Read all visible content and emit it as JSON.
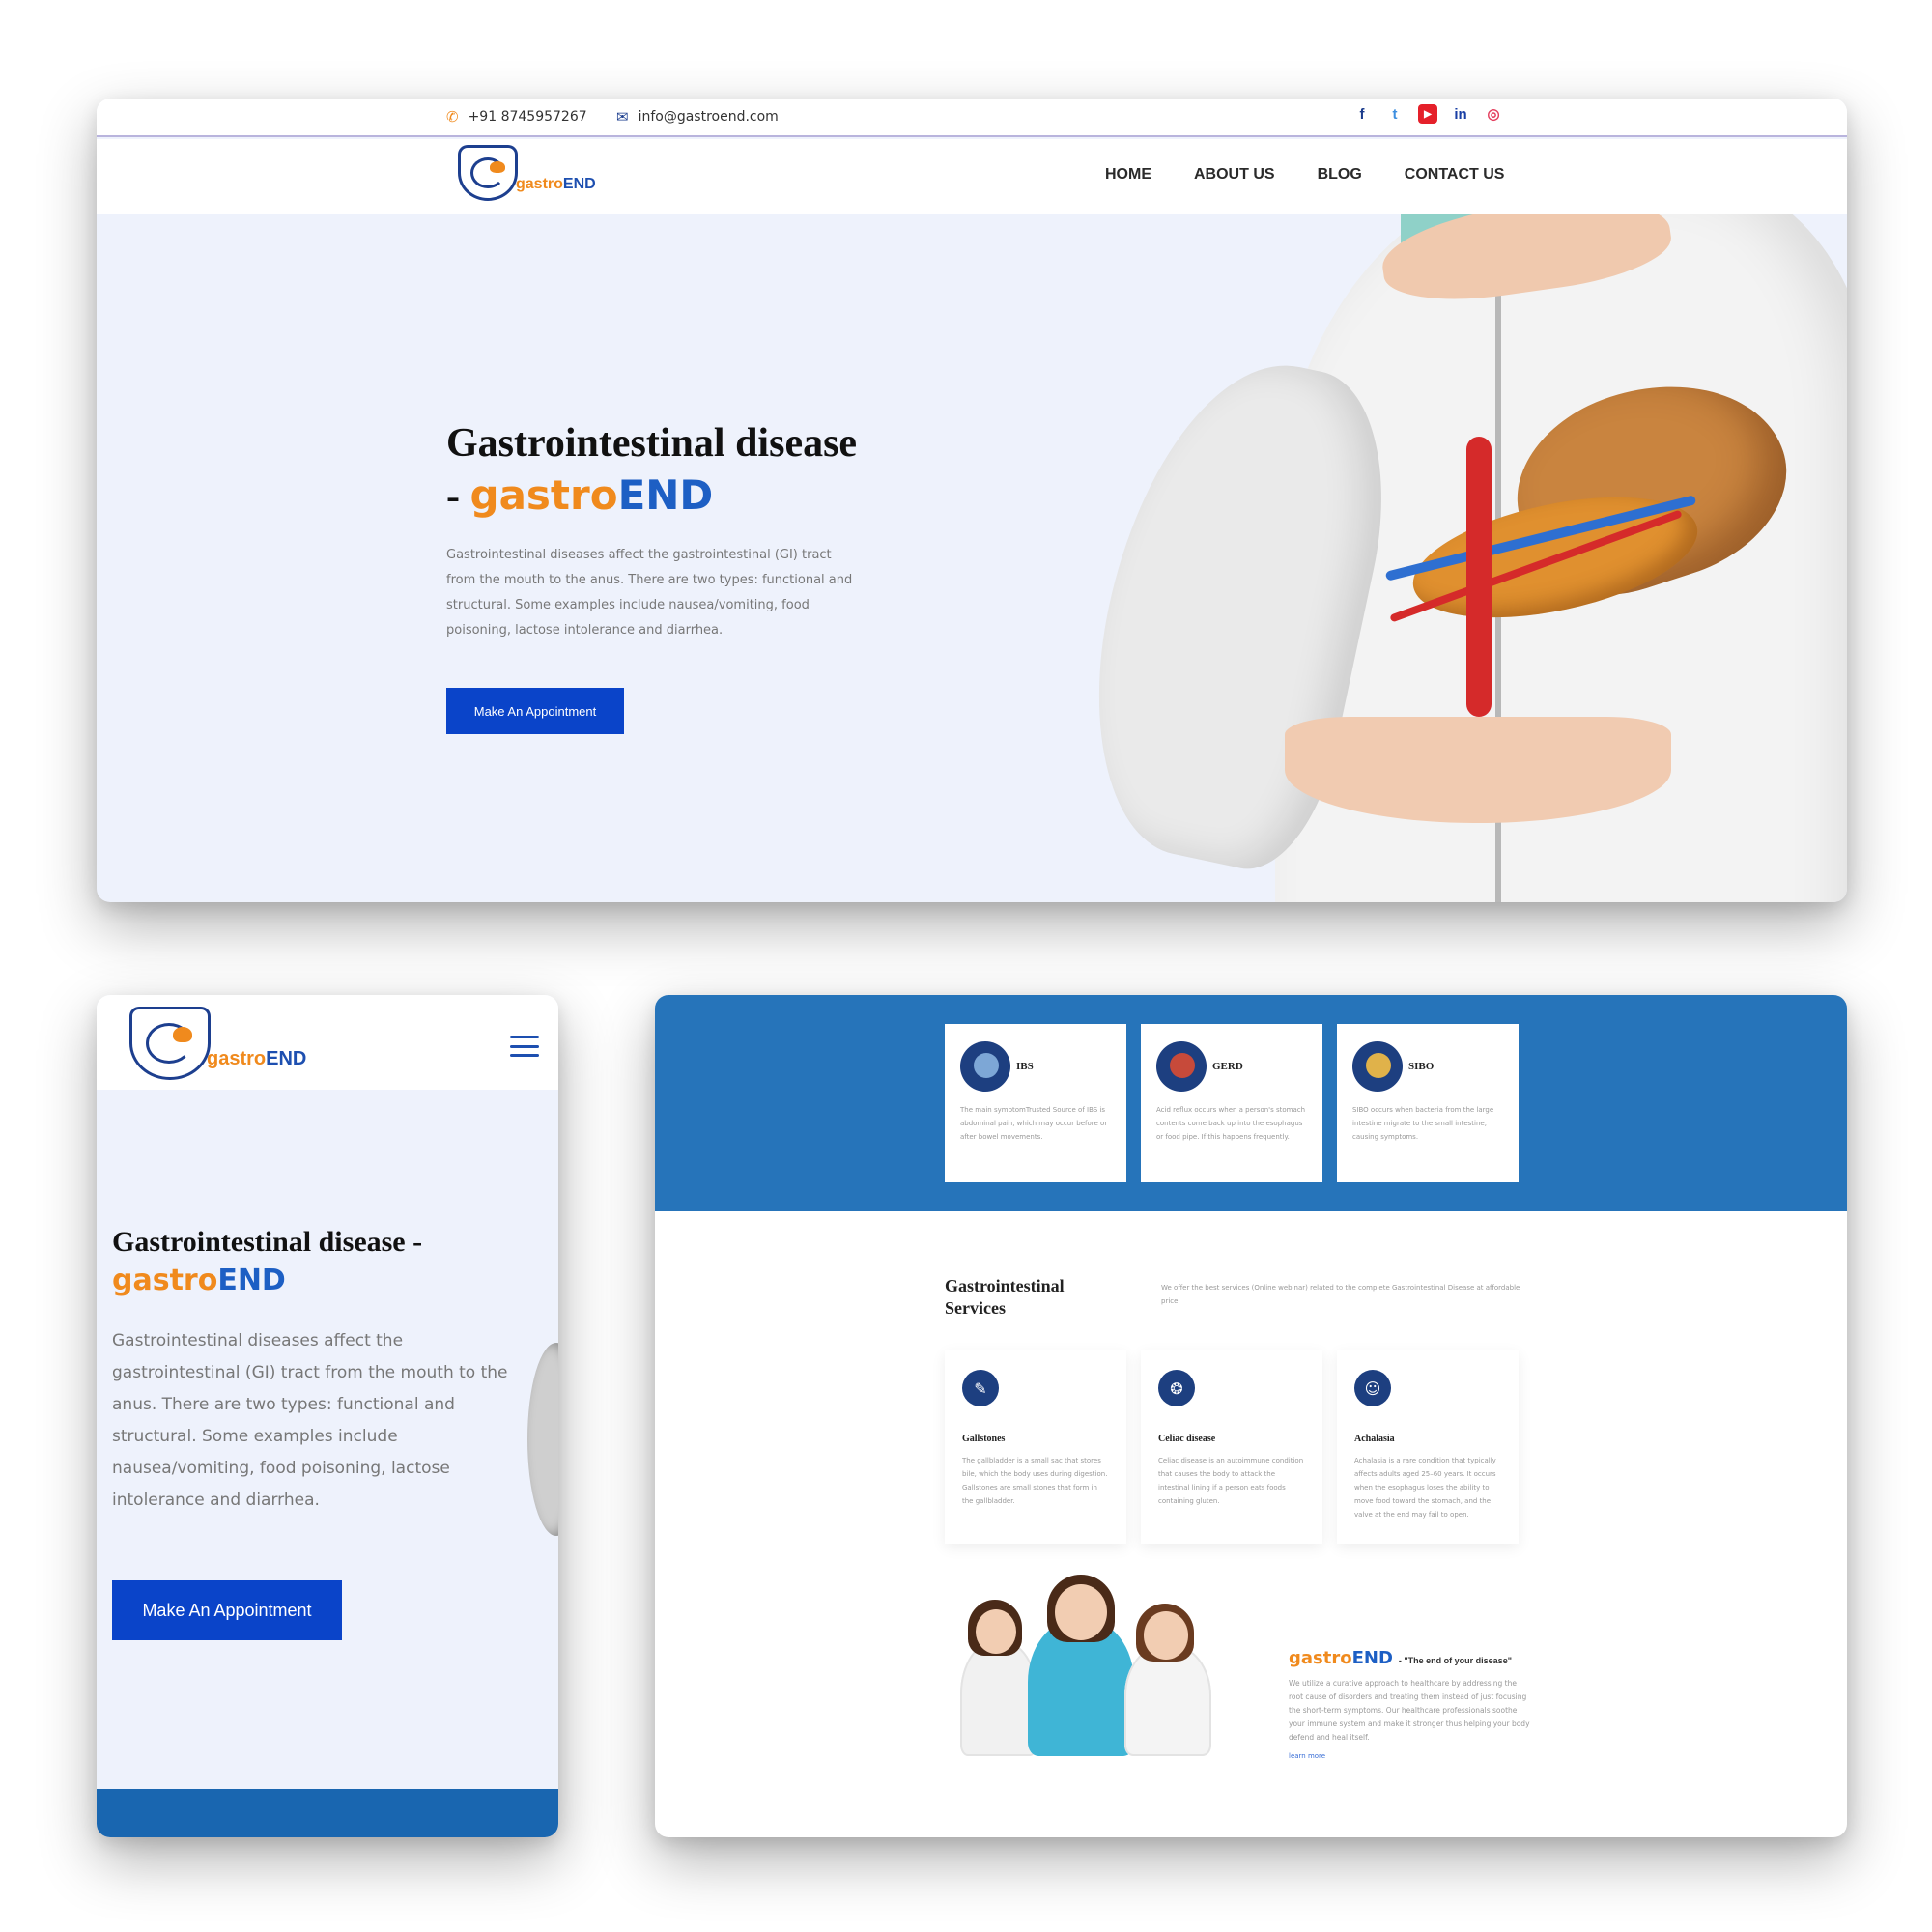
{
  "brand": {
    "part1": "gastro",
    "part2": "END"
  },
  "colors": {
    "accent_orange": "#f08a1d",
    "accent_blue": "#1d5fc4",
    "button_blue": "#0a44c9",
    "band_blue": "#2674ba",
    "hero_bg": "#eef2fc"
  },
  "topbar": {
    "phone": "+91 8745957267",
    "email": "info@gastroend.com",
    "social": [
      {
        "icon": "facebook-icon",
        "glyph": "f",
        "color": "#1b3c8c"
      },
      {
        "icon": "twitter-icon",
        "glyph": "t",
        "color": "#3d8fe0"
      },
      {
        "icon": "youtube-icon",
        "glyph": "▶",
        "color": "#e5202a"
      },
      {
        "icon": "linkedin-icon",
        "glyph": "in",
        "color": "#1a3fa5"
      },
      {
        "icon": "instagram-icon",
        "glyph": "◎",
        "color": "#e4405f"
      }
    ]
  },
  "nav": {
    "home": "HOME",
    "about": "ABOUT US",
    "blog": "BLOG",
    "contact": "CONTACT US"
  },
  "hero": {
    "title_line1": "Gastrointestinal disease",
    "title_dash": "-",
    "mobile_title": "Gastrointestinal disease -",
    "description": "Gastrointestinal diseases affect the gastrointestinal (GI) tract from the mouth to the anus. There are two types: functional and structural. Some examples include nausea/vomiting, food poisoning, lactose intolerance and diarrhea.",
    "cta": "Make An Appointment"
  },
  "featured": [
    {
      "name": "IBS",
      "text": "The main symptomTrusted Source of IBS is abdominal pain, which may occur before or after bowel movements."
    },
    {
      "name": "GERD",
      "text": "Acid reflux occurs when a person's stomach contents come back up into the esophagus or food pipe. If this happens frequently."
    },
    {
      "name": "SIBO",
      "text": "SIBO occurs when bacteria from the large intestine migrate to the small intestine, causing symptoms."
    }
  ],
  "services": {
    "title": "Gastrointestinal Services",
    "description": "We offer the best services (Online webinar) related to the complete Gastrointestinal Disease at affordable price",
    "items": [
      {
        "name": "Gallstones",
        "icon": "gallbladder-icon",
        "text": "The gallbladder is a small sac that stores bile, which the body uses during digestion. Gallstones are small stones that form in the gallbladder."
      },
      {
        "name": "Celiac disease",
        "icon": "intestine-icon",
        "text": "Celiac disease is an autoimmune condition that causes the body to attack the intestinal lining if a person eats foods containing gluten."
      },
      {
        "name": "Achalasia",
        "icon": "body-icon",
        "text": "Achalasia is a rare condition that typically affects adults aged 25–60 years. It occurs when the esophagus loses the ability to move food toward the stomach, and the valve at the end may fail to open."
      }
    ]
  },
  "about": {
    "tagline": "- \"The end of your disease\"",
    "text": "We utilize a curative approach to healthcare by addressing the root cause of disorders and treating them instead of just focusing the short-term symptoms. Our healthcare professionals soothe your immune system and make it stronger thus helping your body defend and heal itself.",
    "link": "learn more"
  }
}
